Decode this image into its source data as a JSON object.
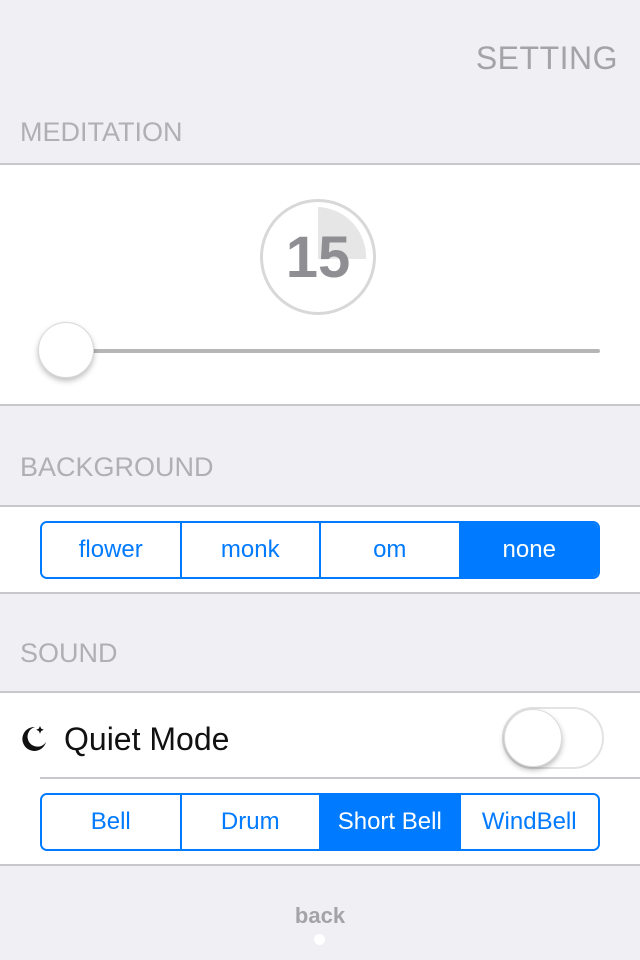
{
  "header": {
    "title": "SETTING"
  },
  "meditation": {
    "label": "MEDITATION",
    "timer_value": "15",
    "slider_value_fraction": 0.0
  },
  "background": {
    "label": "BACKGROUND",
    "options": [
      "flower",
      "monk",
      "om",
      "none"
    ],
    "selected": "none"
  },
  "sound": {
    "label": "SOUND",
    "quiet_mode": {
      "label": "Quiet Mode",
      "enabled": false,
      "icon": "moon-icon"
    },
    "options": [
      "Bell",
      "Drum",
      "Short Bell",
      "WindBell"
    ],
    "selected": "Short Bell"
  },
  "footer": {
    "back_label": "back",
    "page_indicator": {
      "pages": 1,
      "current": 1
    }
  },
  "colors": {
    "accent": "#007aff",
    "background": "#efeff4",
    "label_gray": "#b0b0b4"
  }
}
